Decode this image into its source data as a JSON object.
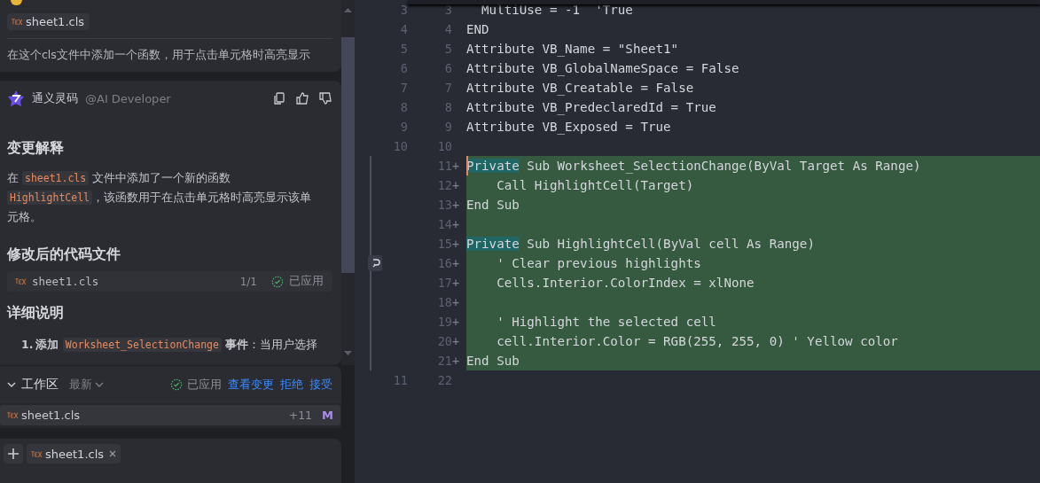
{
  "chat": {
    "user_message": {
      "attachment": "sheet1.cls",
      "text": "在这个cls文件中添加一个函数，用于点击单元格时高亮显示"
    },
    "assistant": {
      "name": "通义灵码",
      "handle": "@AI Developer",
      "sections": [
        {
          "kind": "heading",
          "text": "变更解释"
        },
        {
          "kind": "paragraph",
          "parts": [
            {
              "text": "在 "
            },
            {
              "code": "sheet1.cls"
            },
            {
              "text": " 文件中添加了一个新的函数 "
            },
            {
              "code": "HighlightCell"
            },
            {
              "text": "，该函数用于在点击单元格时高亮显示该单元格。"
            }
          ]
        },
        {
          "kind": "heading",
          "text": "修改后的代码文件"
        },
        {
          "kind": "file",
          "name": "sheet1.cls",
          "count": "1/1",
          "status": "已应用"
        },
        {
          "kind": "heading",
          "text": "详细说明"
        },
        {
          "kind": "list",
          "items": [
            {
              "number": "1.",
              "parts": [
                {
                  "text": "添加 ",
                  "bold": true
                },
                {
                  "code": "Worksheet_SelectionChange"
                },
                {
                  "text": " 事件",
                  "bold": true
                },
                {
                  "text": "：当用户选择"
                }
              ]
            }
          ]
        }
      ]
    }
  },
  "workspace": {
    "title": "工作区",
    "filter": "最新",
    "status": "已应用",
    "actions": [
      "查看变更",
      "拒绝",
      "接受"
    ],
    "files": [
      {
        "name": "sheet1.cls",
        "additions": "+11",
        "badge": "M"
      }
    ]
  },
  "composer": {
    "context_files": [
      "sheet1.cls"
    ]
  },
  "editor": {
    "lines": [
      {
        "old": "3",
        "new": "3",
        "added": false,
        "cursor": false,
        "revert": false,
        "segments": [
          {
            "text": "  MultiUse = -1  'True"
          }
        ]
      },
      {
        "old": "4",
        "new": "4",
        "added": false,
        "cursor": false,
        "revert": false,
        "segments": [
          {
            "text": "END"
          }
        ]
      },
      {
        "old": "5",
        "new": "5",
        "added": false,
        "cursor": false,
        "revert": false,
        "segments": [
          {
            "text": "Attribute VB_Name = \"Sheet1\""
          }
        ]
      },
      {
        "old": "6",
        "new": "6",
        "added": false,
        "cursor": false,
        "revert": false,
        "segments": [
          {
            "text": "Attribute VB_GlobalNameSpace = False"
          }
        ]
      },
      {
        "old": "7",
        "new": "7",
        "added": false,
        "cursor": false,
        "revert": false,
        "segments": [
          {
            "text": "Attribute VB_Creatable = False"
          }
        ]
      },
      {
        "old": "8",
        "new": "8",
        "added": false,
        "cursor": false,
        "revert": false,
        "segments": [
          {
            "text": "Attribute VB_PredeclaredId = True"
          }
        ]
      },
      {
        "old": "9",
        "new": "9",
        "added": false,
        "cursor": false,
        "revert": false,
        "segments": [
          {
            "text": "Attribute VB_Exposed = True"
          }
        ]
      },
      {
        "old": "10",
        "new": "10",
        "added": false,
        "cursor": false,
        "revert": false
      },
      {
        "new": "11",
        "marker": "+",
        "added": true,
        "cursor": true,
        "revert": false,
        "segments": [
          {
            "text": "Private",
            "changed": true
          },
          {
            "text": " Sub Worksheet_SelectionChange(ByVal Target As Range)"
          }
        ]
      },
      {
        "new": "12",
        "marker": "+",
        "added": true,
        "cursor": false,
        "revert": false,
        "segments": [
          {
            "text": "    Call HighlightCell(Target)"
          }
        ]
      },
      {
        "new": "13",
        "marker": "+",
        "added": true,
        "cursor": false,
        "revert": false,
        "segments": [
          {
            "text": "End Sub"
          }
        ]
      },
      {
        "new": "14",
        "marker": "+",
        "added": true,
        "cursor": false,
        "revert": false
      },
      {
        "new": "15",
        "marker": "+",
        "added": true,
        "cursor": false,
        "revert": false,
        "segments": [
          {
            "text": "Private",
            "changed": true
          },
          {
            "text": " Sub HighlightCell(ByVal cell As Range)"
          }
        ]
      },
      {
        "new": "16",
        "marker": "+",
        "added": true,
        "cursor": false,
        "revert": true,
        "segments": [
          {
            "text": "    ' Clear previous highlights"
          }
        ]
      },
      {
        "new": "17",
        "marker": "+",
        "added": true,
        "cursor": false,
        "revert": false,
        "segments": [
          {
            "text": "    Cells.Interior.ColorIndex = xlNone"
          }
        ]
      },
      {
        "new": "18",
        "marker": "+",
        "added": true,
        "cursor": false,
        "revert": false
      },
      {
        "new": "19",
        "marker": "+",
        "added": true,
        "cursor": false,
        "revert": false,
        "segments": [
          {
            "text": "    ' Highlight the selected cell"
          }
        ]
      },
      {
        "new": "20",
        "marker": "+",
        "added": true,
        "cursor": false,
        "revert": false,
        "segments": [
          {
            "text": "    cell.Interior.Color = RGB(255, 255, 0) ' Yellow color"
          }
        ]
      },
      {
        "new": "21",
        "marker": "+",
        "added": true,
        "cursor": false,
        "revert": false,
        "segments": [
          {
            "text": "End Sub"
          }
        ]
      },
      {
        "old": "11",
        "new": "22",
        "added": false,
        "cursor": false,
        "revert": false
      }
    ]
  }
}
